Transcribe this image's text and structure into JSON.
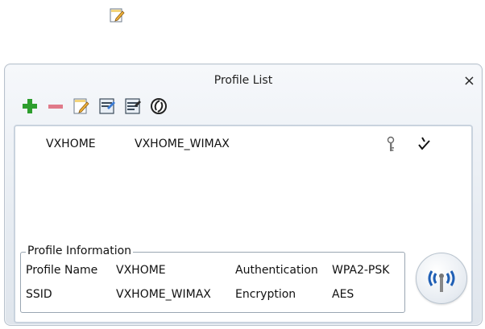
{
  "dialog": {
    "title": "Profile List",
    "close_label": "×"
  },
  "toolbar": {
    "icons": [
      "add-icon",
      "remove-icon",
      "edit-icon",
      "import-icon",
      "export-icon",
      "connect-icon"
    ]
  },
  "profiles": [
    {
      "name": "VXHOME",
      "ssid": "VXHOME_WIMAX"
    }
  ],
  "info": {
    "legend": "Profile Information",
    "profile_name_label": "Profile Name",
    "profile_name": "VXHOME",
    "ssid_label": "SSID",
    "ssid": "VXHOME_WIMAX",
    "authentication_label": "Authentication",
    "authentication": "WPA2-PSK",
    "encryption_label": "Encryption",
    "encryption": "AES"
  },
  "colors": {
    "add": "#2e9e2e",
    "remove": "#e07a8a",
    "signal_wave": "#1f5fb5"
  }
}
